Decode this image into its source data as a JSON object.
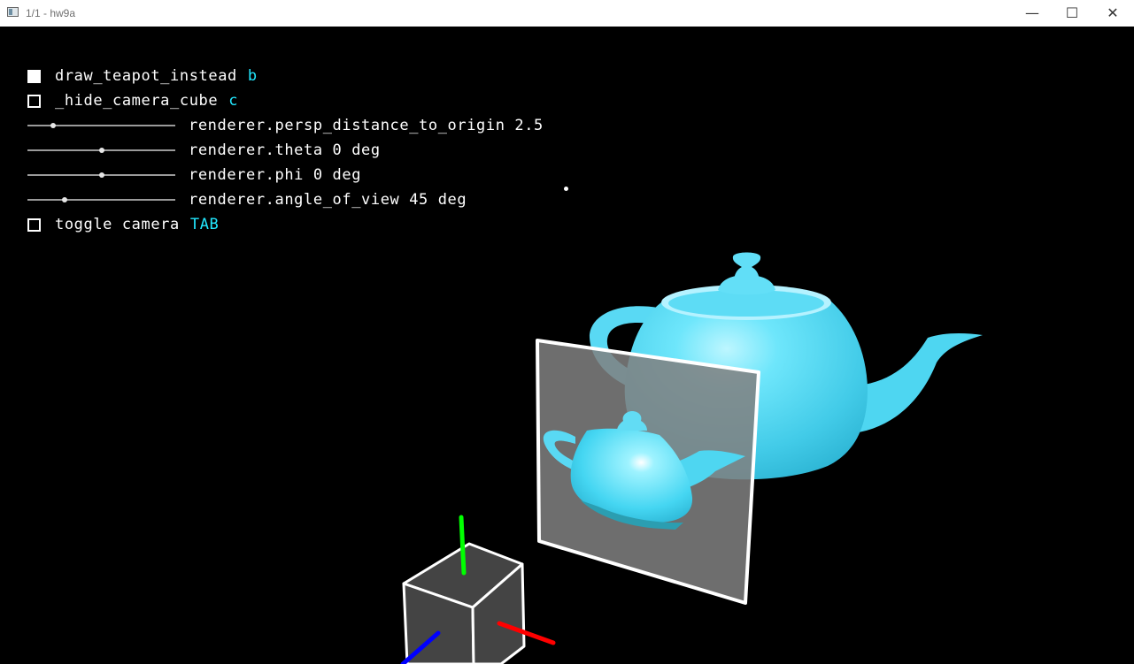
{
  "window": {
    "title": "1/1 - hw9a",
    "minimize": "—",
    "maximize": "☐",
    "close": "✕"
  },
  "hud": {
    "checkboxes": [
      {
        "label": "draw_teapot_instead",
        "key": "b",
        "checked": true
      },
      {
        "label": "_hide_camera_cube",
        "key": "c",
        "checked": false
      },
      {
        "label": "toggle camera",
        "key": "TAB",
        "checked": false
      }
    ],
    "sliders": [
      {
        "label": "renderer.persp_distance_to_origin 2.5",
        "value_fraction": 0.17
      },
      {
        "label": "renderer.theta 0 deg",
        "value_fraction": 0.5
      },
      {
        "label": "renderer.phi 0 deg",
        "value_fraction": 0.5
      },
      {
        "label": "renderer.angle_of_view 45 deg",
        "value_fraction": 0.25
      }
    ]
  },
  "colors": {
    "teapot": "#57dcf6",
    "axis_x": "#ff0000",
    "axis_y": "#00ff00",
    "axis_z": "#0000ff",
    "image_plane": "#808080",
    "background": "#000000"
  }
}
